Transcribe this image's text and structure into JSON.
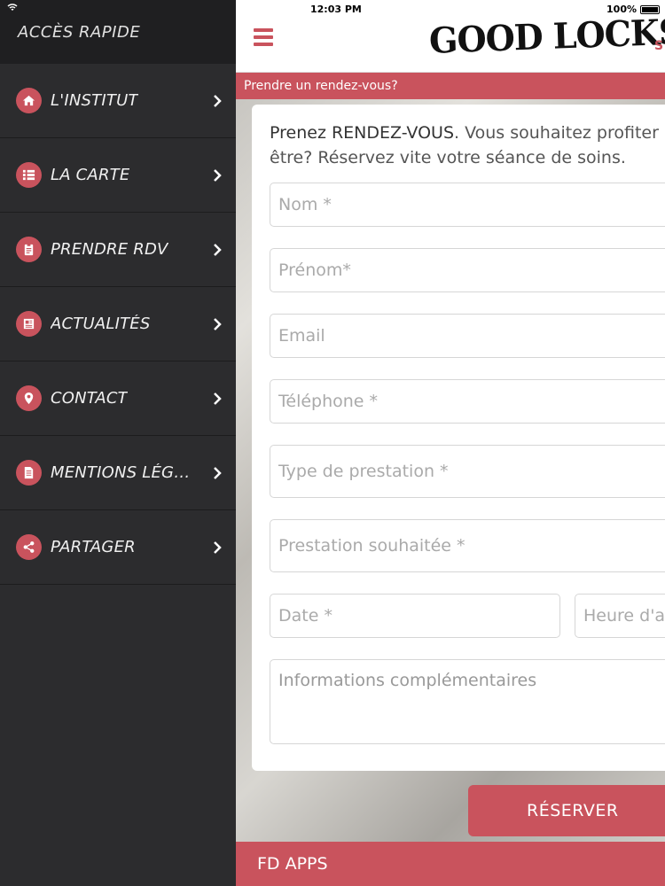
{
  "sidebar": {
    "title": "ACCÈS RAPIDE",
    "items": [
      {
        "label": "L'INSTITUT",
        "icon": "home-icon"
      },
      {
        "label": "LA CARTE",
        "icon": "list-icon"
      },
      {
        "label": "PRENDRE RDV",
        "icon": "clipboard-icon"
      },
      {
        "label": "ACTUALITÉS",
        "icon": "newspaper-icon"
      },
      {
        "label": "CONTACT",
        "icon": "location-pin-icon"
      },
      {
        "label": "MENTIONS LÉGA...",
        "icon": "document-icon"
      },
      {
        "label": "PARTAGER",
        "icon": "share-icon"
      }
    ]
  },
  "status": {
    "time": "12:03 PM",
    "battery": "100%"
  },
  "header": {
    "logo": "GOOD LOCKS",
    "logo_suffix": "S"
  },
  "subheader": "Prendre un rendez-vous?",
  "form": {
    "intro_bold": "Prenez RENDEZ-VOUS",
    "intro_line1_rest": ". Vous souhaitez profiter",
    "intro_line2": "être? Réservez vite votre séance de soins.",
    "fields": {
      "nom": "Nom *",
      "prenom": "Prénom*",
      "email": "Email",
      "telephone": "Téléphone *",
      "type_prestation": "Type de prestation *",
      "prestation_souhaitee": "Prestation souhaitée *",
      "date": "Date *",
      "heure": "Heure d'a",
      "informations": "Informations complémentaires"
    },
    "submit": "RÉSERVER"
  },
  "footer": "FD APPS",
  "colors": {
    "accent": "#c9535d",
    "sidebar_bg": "#2c2c2e",
    "sidebar_header": "#1f1f21"
  }
}
